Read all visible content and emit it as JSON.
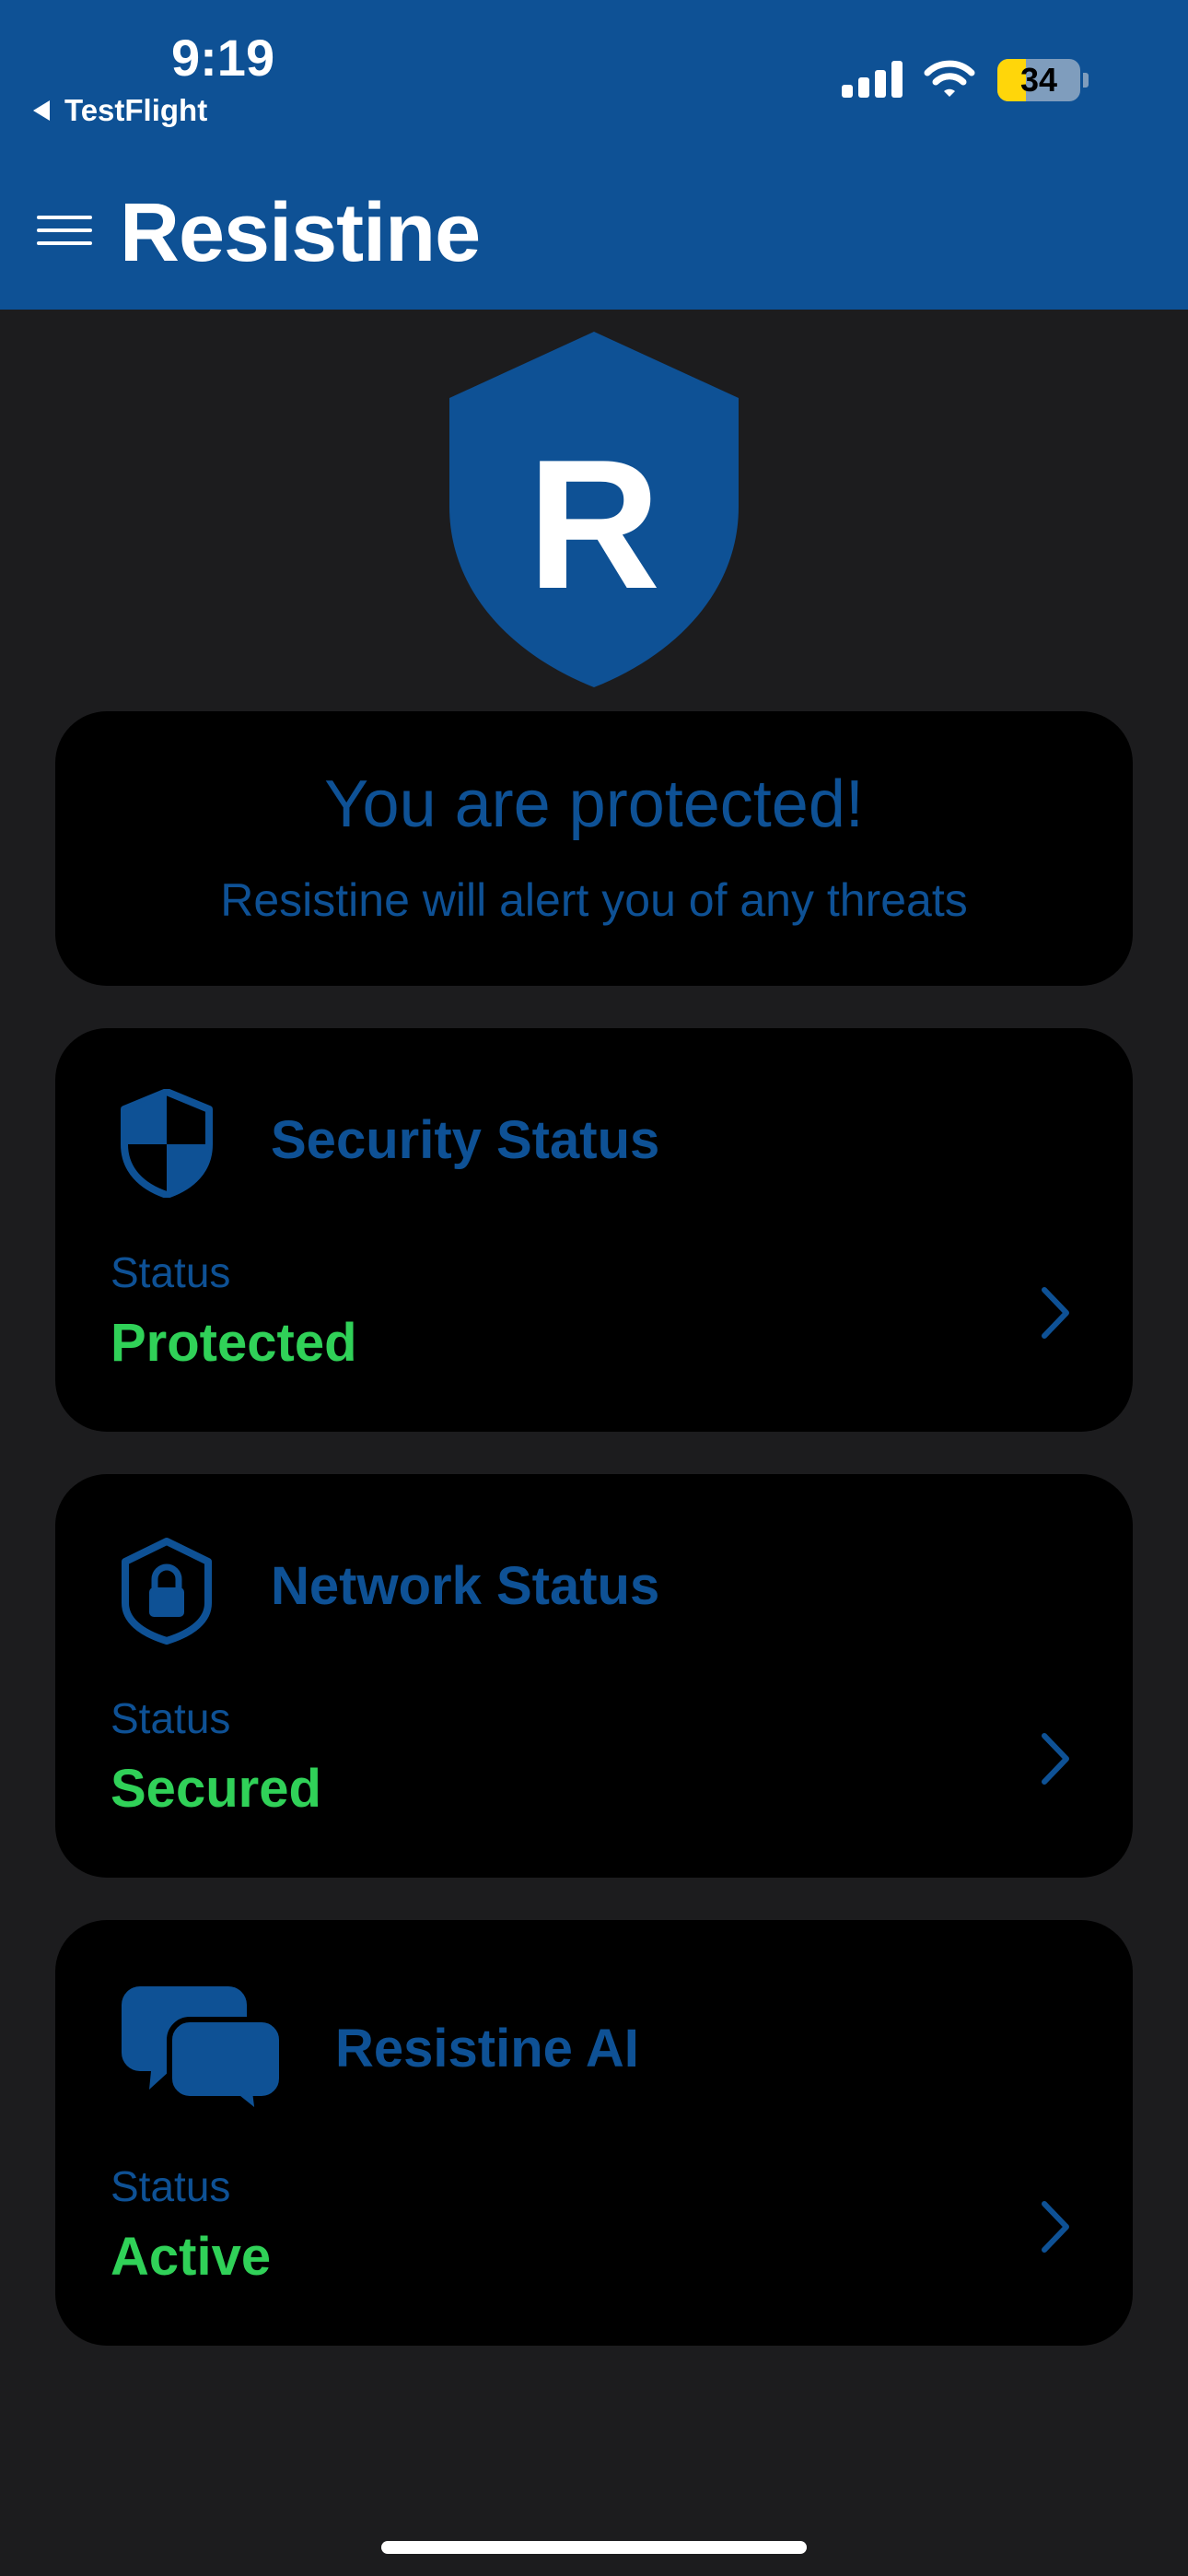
{
  "status_bar": {
    "time": "9:19",
    "back_label": "TestFlight",
    "battery_level": "34"
  },
  "header": {
    "title": "Resistine"
  },
  "logo": {
    "letter": "R",
    "color": "#0e5195"
  },
  "hero": {
    "title": "You are protected!",
    "subtitle": "Resistine will alert you of any threats"
  },
  "cards": [
    {
      "title": "Security Status",
      "icon": "shield-checkered-icon",
      "status_label": "Status",
      "status_value": "Protected"
    },
    {
      "title": "Network Status",
      "icon": "shield-lock-icon",
      "status_label": "Status",
      "status_value": "Secured"
    },
    {
      "title": "Resistine AI",
      "icon": "chat-bubbles-icon",
      "status_label": "Status",
      "status_value": "Active"
    }
  ],
  "colors": {
    "brand_blue": "#0e5195",
    "background": "#1c1c1e",
    "card": "#000000",
    "status_green": "#30d158"
  }
}
